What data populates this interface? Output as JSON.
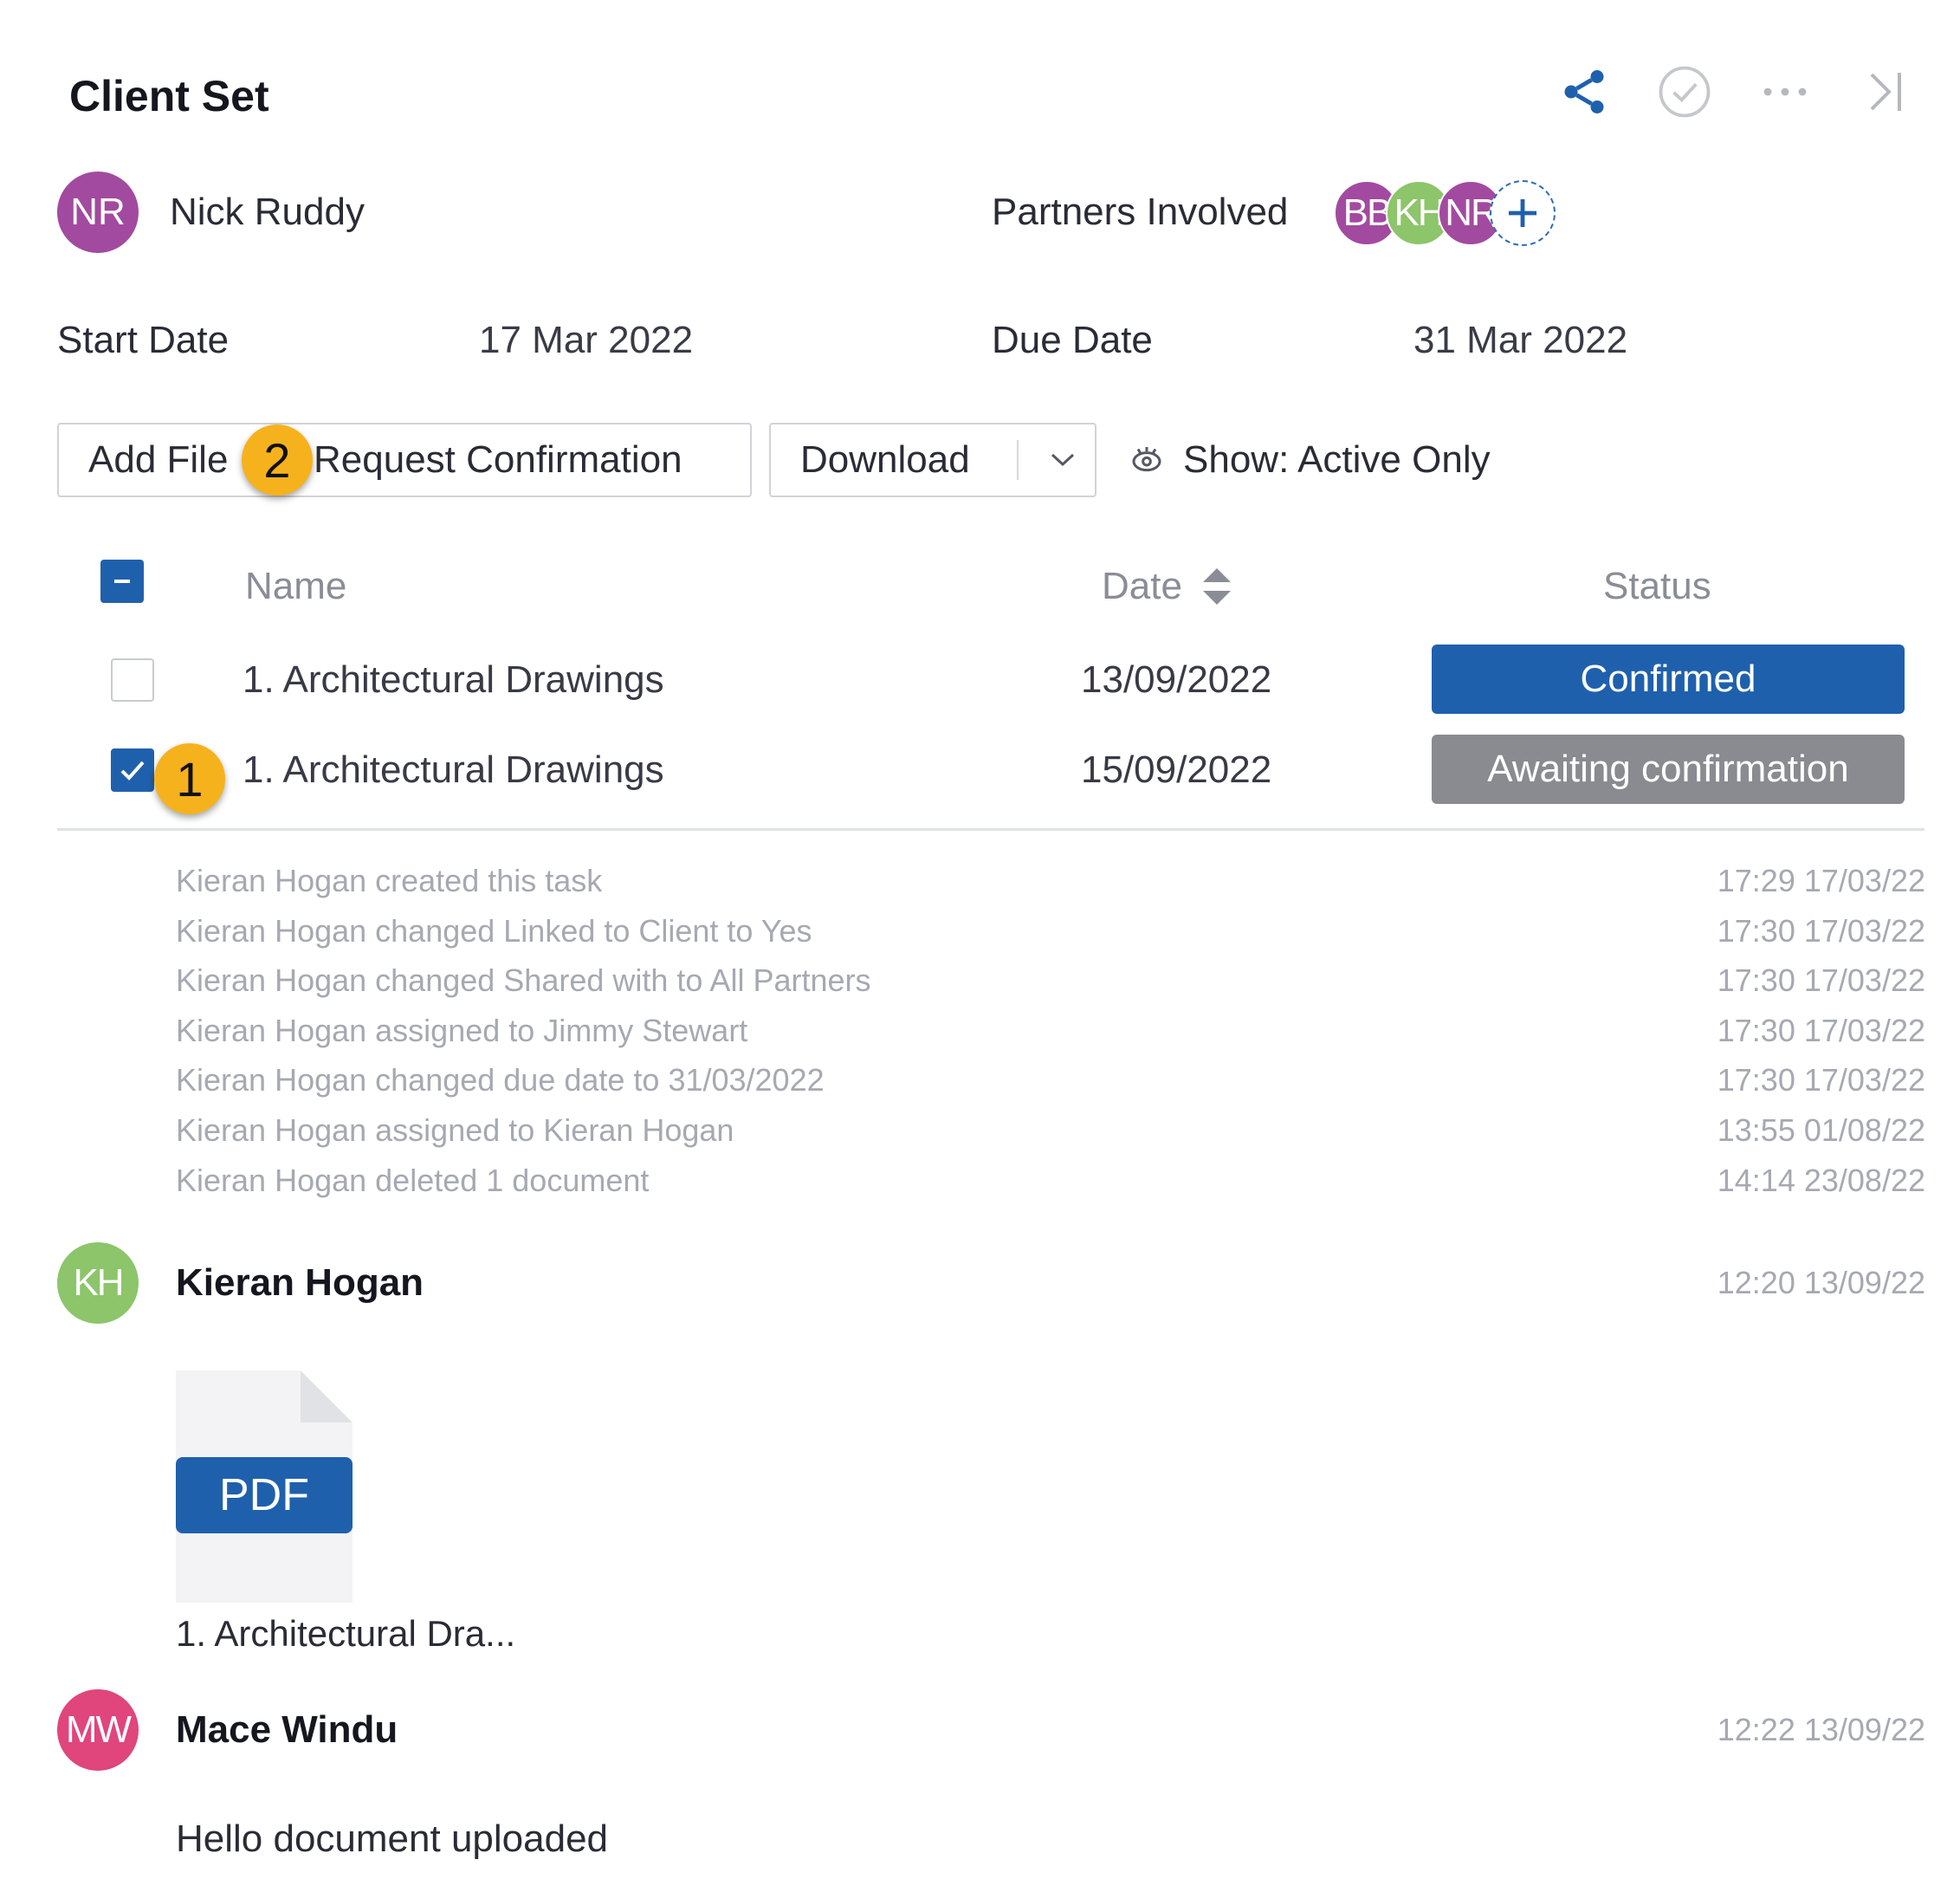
{
  "header": {
    "title": "Client Set"
  },
  "top_actions": [
    {
      "icon": "share-icon"
    },
    {
      "icon": "check-circle-icon"
    },
    {
      "icon": "more-icon"
    },
    {
      "icon": "collapse-panel-icon"
    }
  ],
  "owner": {
    "initials": "NR",
    "name": "Nick Ruddy",
    "color": "#a24a9f"
  },
  "partners": {
    "label": "Partners Involved",
    "avatars": [
      {
        "initials": "BB",
        "color": "#a24a9f"
      },
      {
        "initials": "KH",
        "color": "#8cc56a"
      },
      {
        "initials": "NR",
        "color": "#a24a9f"
      }
    ],
    "add_icon": "plus-icon"
  },
  "dates": {
    "start_label": "Start Date",
    "start_value": "17 Mar 2022",
    "due_label": "Due Date",
    "due_value": "31 Mar 2022"
  },
  "toolbar": {
    "add_file_label": "Add File",
    "request_label": "Request Confirmation",
    "download_label": "Download",
    "show_label": "Show: Active Only"
  },
  "callouts": {
    "one": "1",
    "two": "2"
  },
  "table": {
    "headers": {
      "name": "Name",
      "date": "Date",
      "status": "Status"
    },
    "rows": [
      {
        "name": "1. Architectural Drawings",
        "date": "13/09/2022",
        "status": "Confirmed",
        "status_color": "#1f60ad",
        "checked": false
      },
      {
        "name": "1. Architectural Drawings",
        "date": "15/09/2022",
        "status": "Awaiting confirmation",
        "status_color": "#8a8b90",
        "checked": true
      }
    ]
  },
  "activity": [
    {
      "text": "Kieran Hogan created this task",
      "time": "17:29 17/03/22"
    },
    {
      "text": "Kieran Hogan changed Linked to Client to Yes",
      "time": "17:30 17/03/22"
    },
    {
      "text": "Kieran Hogan changed Shared with to All Partners",
      "time": "17:30 17/03/22"
    },
    {
      "text": "Kieran Hogan assigned to Jimmy Stewart",
      "time": "17:30 17/03/22"
    },
    {
      "text": "Kieran Hogan changed due date to 31/03/2022",
      "time": "17:30 17/03/22"
    },
    {
      "text": "Kieran Hogan assigned to Kieran Hogan",
      "time": "13:55 01/08/22"
    },
    {
      "text": "Kieran Hogan deleted 1 document",
      "time": "14:14 23/08/22"
    }
  ],
  "comments": [
    {
      "initials": "KH",
      "author": "Kieran Hogan",
      "time": "12:20 13/09/22",
      "color": "#8cc56a",
      "file": {
        "badge": "PDF",
        "name": "1. Architectural Dra..."
      }
    },
    {
      "initials": "MW",
      "author": "Mace Windu",
      "time": "12:22 13/09/22",
      "color": "#e0457b",
      "message": "Hello document uploaded"
    }
  ]
}
